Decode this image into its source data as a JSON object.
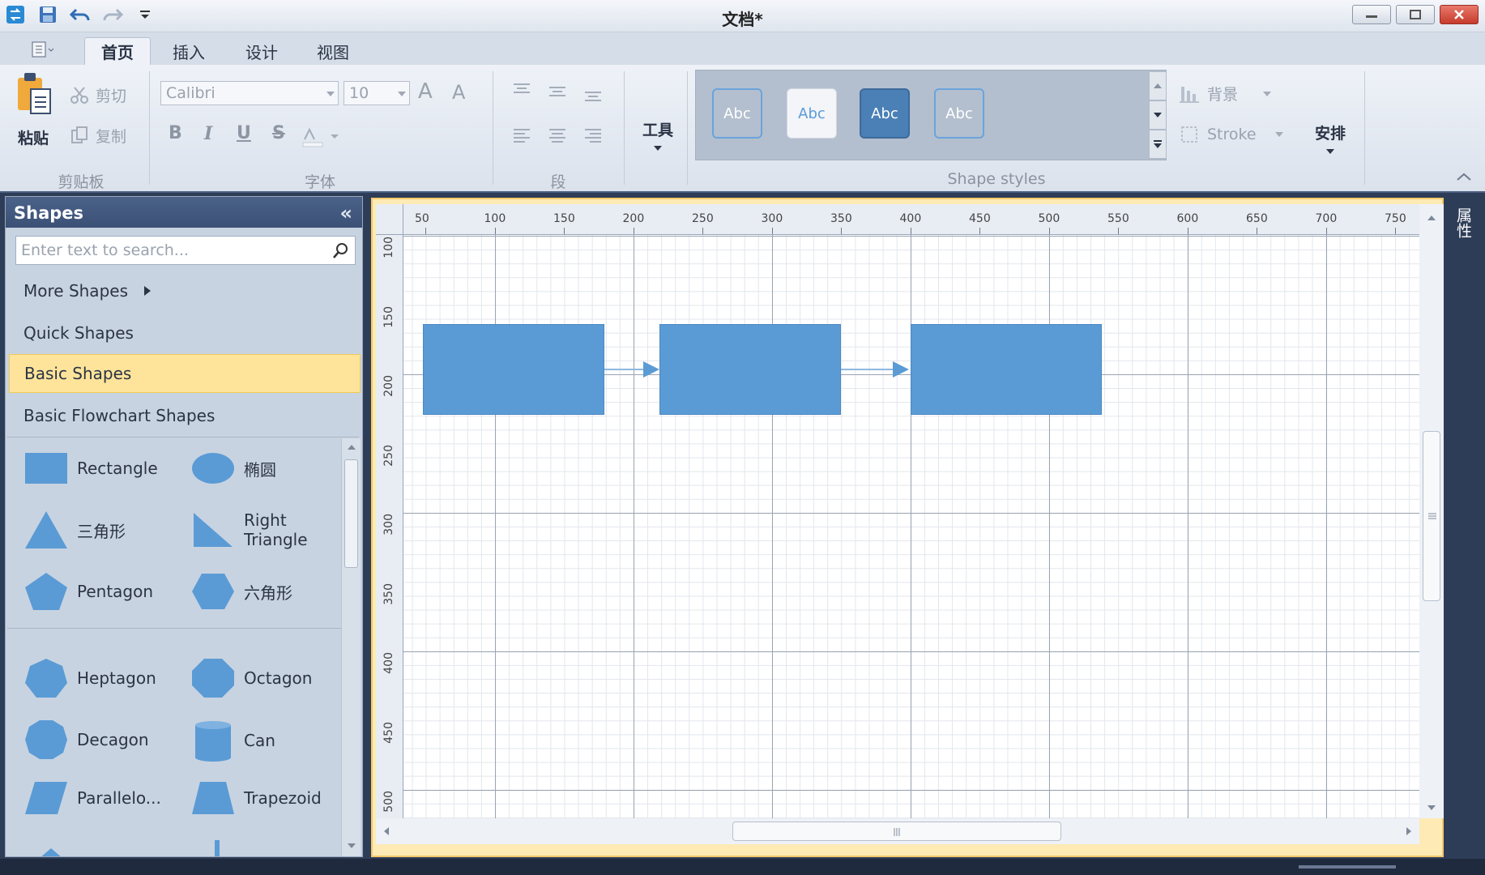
{
  "window": {
    "title": "文档*"
  },
  "tabs": [
    {
      "label": "首页",
      "active": true
    },
    {
      "label": "插入",
      "active": false
    },
    {
      "label": "设计",
      "active": false
    },
    {
      "label": "视图",
      "active": false
    }
  ],
  "ribbon": {
    "clipboard": {
      "paste": "粘贴",
      "cut": "剪切",
      "copy": "复制",
      "group_label": "剪贴板"
    },
    "font": {
      "family": "Calibri",
      "size": "10",
      "grow": "A",
      "shrink": "A",
      "bold": "B",
      "italic": "I",
      "underline": "U",
      "strike": "S",
      "group_label": "字体"
    },
    "paragraph": {
      "group_label": "段"
    },
    "tools": {
      "label": "工具"
    },
    "shape_styles": {
      "group_label": "Shape styles",
      "swatches": [
        {
          "label": "Abc",
          "bg": "#5a9bd5",
          "fg": "#ffffff"
        },
        {
          "label": "Abc",
          "bg": "#f3f5f9",
          "fg": "#5a9bd5"
        },
        {
          "label": "Abc",
          "bg": "#4a80b6",
          "fg": "#ffffff"
        },
        {
          "label": "Abc",
          "bg": "#5a9bd5",
          "fg": "#ffffff"
        }
      ]
    },
    "fill": {
      "label": "背景"
    },
    "stroke": {
      "label": "Stroke"
    },
    "arrange": {
      "label": "安排"
    }
  },
  "shapes_panel": {
    "title": "Shapes",
    "search_placeholder": "Enter text to search...",
    "categories": [
      {
        "label": "More Shapes",
        "selected": false
      },
      {
        "label": "Quick Shapes",
        "selected": false
      },
      {
        "label": "Basic Shapes",
        "selected": true
      },
      {
        "label": "Basic Flowchart Shapes",
        "selected": false
      }
    ],
    "items": [
      {
        "label": "Rectangle",
        "shape": "rectangle"
      },
      {
        "label": "椭圆",
        "shape": "ellipse"
      },
      {
        "label": "三角形",
        "shape": "triangle"
      },
      {
        "label": "Right Triangle",
        "shape": "right-triangle"
      },
      {
        "label": "Pentagon",
        "shape": "pentagon"
      },
      {
        "label": "六角形",
        "shape": "hexagon"
      },
      {
        "label": "Heptagon",
        "shape": "heptagon"
      },
      {
        "label": "Octagon",
        "shape": "octagon"
      },
      {
        "label": "Decagon",
        "shape": "decagon"
      },
      {
        "label": "Can",
        "shape": "can"
      },
      {
        "label": "Parallelo...",
        "shape": "parallelogram"
      },
      {
        "label": "Trapezoid",
        "shape": "trapezoid"
      }
    ]
  },
  "canvas": {
    "ruler_top": [
      "50",
      "100",
      "150",
      "200",
      "250",
      "300",
      "350",
      "400",
      "450",
      "500",
      "550",
      "600",
      "650",
      "700",
      "750"
    ],
    "ruler_left": [
      "100",
      "150",
      "200",
      "250",
      "300",
      "350",
      "400",
      "450",
      "500"
    ],
    "shape_color": "#5a9bd5"
  },
  "side_panel": {
    "label": "属性"
  }
}
